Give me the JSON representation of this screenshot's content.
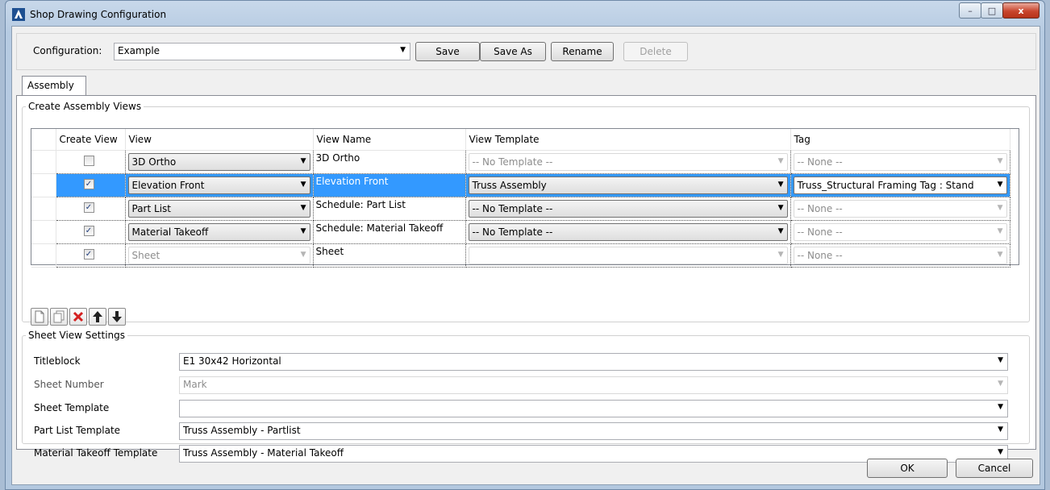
{
  "window": {
    "title": "Shop Drawing Configuration",
    "minimize": "–",
    "maximize": "□",
    "close": "x"
  },
  "config": {
    "label": "Configuration:",
    "value": "Example",
    "save": "Save",
    "save_as": "Save As",
    "rename": "Rename",
    "delete": "Delete"
  },
  "tab": {
    "label": "Assembly"
  },
  "views": {
    "legend": "Create Assembly Views",
    "columns": [
      "Create View",
      "View",
      "View Name",
      "View Template",
      "Tag"
    ],
    "rows": [
      {
        "create": false,
        "view": "3D Ortho",
        "name": "3D Ortho",
        "template": "-- No Template --",
        "tag": "-- None --"
      },
      {
        "create": true,
        "view": "Elevation Front",
        "name": "Elevation Front",
        "template": "Truss Assembly",
        "tag": "Truss_Structural Framing Tag : Stand"
      },
      {
        "create": true,
        "view": "Part List",
        "name": "Schedule: Part List",
        "template": "-- No Template --",
        "tag": "-- None --"
      },
      {
        "create": true,
        "view": "Material Takeoff",
        "name": "Schedule: Material Takeoff",
        "template": "-- No Template --",
        "tag": "-- None --"
      },
      {
        "create": true,
        "view": "Sheet",
        "name": "Sheet",
        "template": "",
        "tag": "-- None --"
      }
    ],
    "check_glyph": "✓"
  },
  "sheet": {
    "legend": "Sheet View Settings",
    "titleblock_label": "Titleblock",
    "titleblock_value": "E1 30x42 Horizontal",
    "sheet_number_label": "Sheet Number",
    "sheet_number_value": "Mark",
    "sheet_template_label": "Sheet Template",
    "sheet_template_value": "",
    "part_list_label": "Part List Template",
    "part_list_value": "Truss Assembly - Partlist",
    "material_label": "Material Takeoff Template",
    "material_value": "Truss Assembly - Material Takeoff"
  },
  "footer": {
    "ok": "OK",
    "cancel": "Cancel"
  },
  "colors": {
    "selection": "#3399ff",
    "delete_red": "#d42020"
  }
}
